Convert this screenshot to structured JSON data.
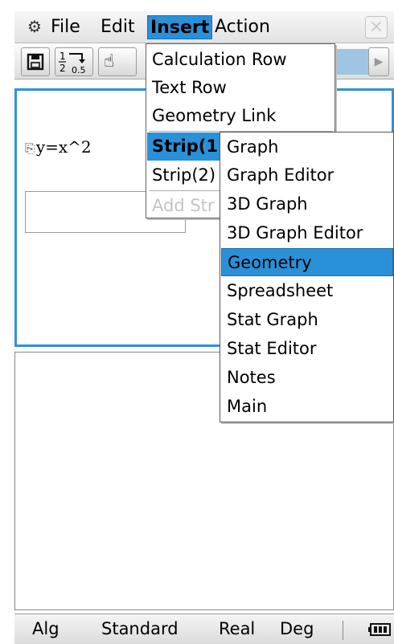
{
  "menubar": {
    "items": [
      "File",
      "Edit",
      "Insert",
      "Action"
    ],
    "selected": "Insert",
    "close_symbol": "×"
  },
  "toolbar": {
    "fraction_top": "1",
    "fraction_bottom": "2",
    "decimal": "0.5"
  },
  "document": {
    "expression": "y=x^2"
  },
  "insert_menu": {
    "items": [
      "Calculation Row",
      "Text Row",
      "Geometry Link",
      "Strip(1)",
      "Strip(2)",
      "Add Str"
    ],
    "selected": "Strip(1)",
    "disabled": "Add Str"
  },
  "strip_submenu": {
    "items": [
      "Graph",
      "Graph Editor",
      "3D Graph",
      "3D Graph Editor",
      "Geometry",
      "Spreadsheet",
      "Stat Graph",
      "Stat Editor",
      "Notes",
      "Main"
    ],
    "selected": "Geometry"
  },
  "status_bar": {
    "mode": "Alg",
    "display": "Standard",
    "number_type": "Real",
    "angle": "Deg"
  },
  "colors": {
    "accent": "#2a91d8",
    "panel_border": "#2d93d6"
  }
}
